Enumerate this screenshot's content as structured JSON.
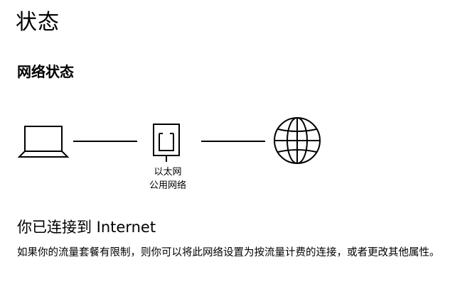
{
  "page": {
    "title": "状态"
  },
  "network_status": {
    "section_title": "网络状态",
    "adapter": {
      "name": "以太网",
      "profile": "公用网络"
    },
    "icons": {
      "computer": "laptop-icon",
      "adapter": "ethernet-icon",
      "internet": "globe-icon"
    },
    "connection_heading": "你已连接到 Internet",
    "connection_description": "如果你的流量套餐有限制，则你可以将此网络设置为按流量计费的连接，或者更改其他属性。"
  }
}
